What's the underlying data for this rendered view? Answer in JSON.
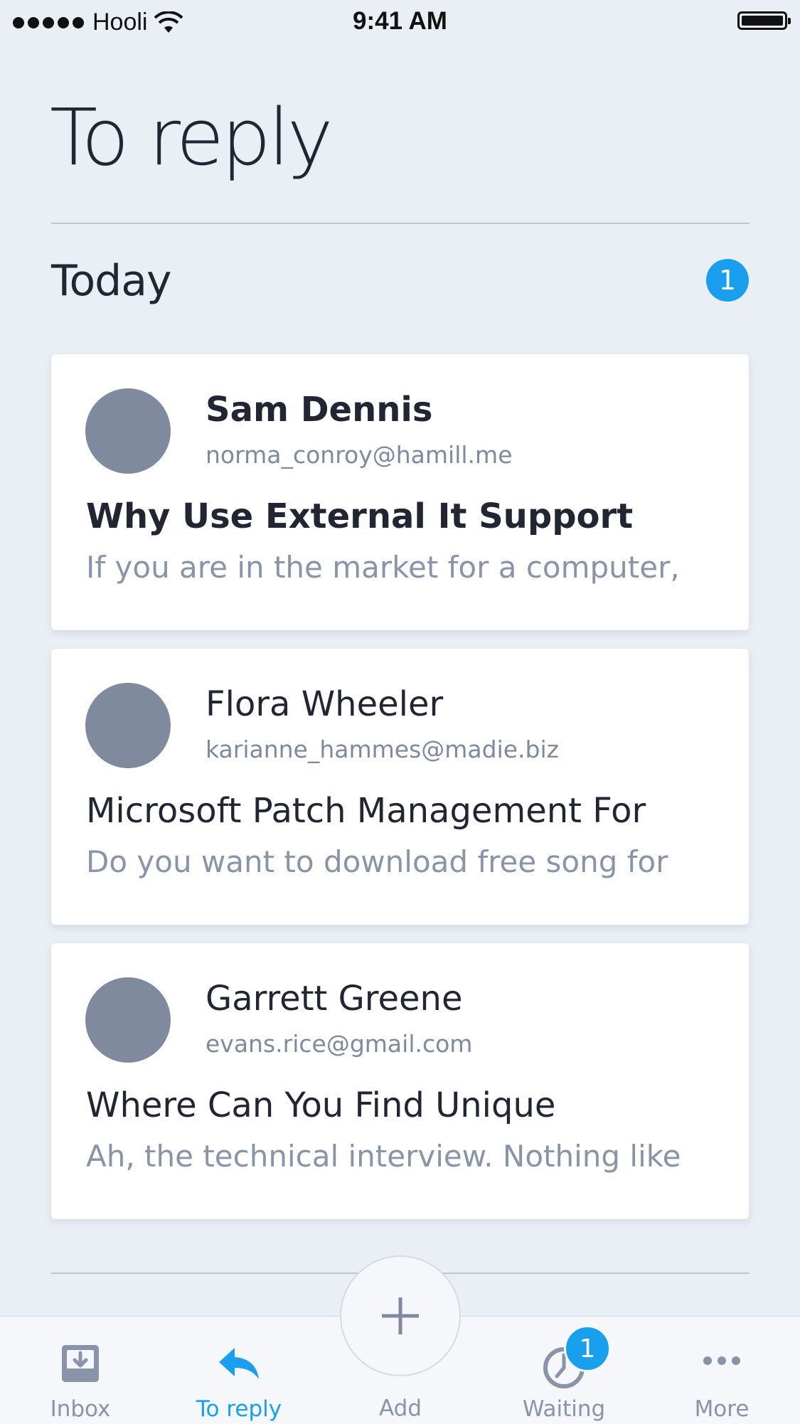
{
  "status_bar": {
    "carrier": "Hooli",
    "time": "9:41 AM"
  },
  "header": {
    "title": "To reply"
  },
  "section": {
    "title": "Today",
    "count": "1"
  },
  "cards": [
    {
      "sender": "Sam Dennis",
      "email": "norma_conroy@hamill.me",
      "subject": "Why Use External It Support",
      "preview": "If you are in the market for a computer,",
      "unread": true
    },
    {
      "sender": "Flora Wheeler",
      "email": "karianne_hammes@madie.biz",
      "subject": "Microsoft Patch Management For",
      "preview": "Do you want to download free song for",
      "unread": false
    },
    {
      "sender": "Garrett Greene",
      "email": "evans.rice@gmail.com",
      "subject": "Where Can You Find Unique",
      "preview": "Ah, the technical interview. Nothing like",
      "unread": false
    }
  ],
  "tab_bar": {
    "inbox": {
      "label": "Inbox",
      "icon": "inbox-icon"
    },
    "to_reply": {
      "label": "To reply",
      "icon": "reply-icon",
      "active": true
    },
    "add": {
      "label": "Add",
      "icon": "plus-icon"
    },
    "waiting": {
      "label": "Waiting",
      "icon": "clock-icon",
      "badge": "1"
    },
    "more": {
      "label": "More",
      "icon": "more-icon"
    }
  },
  "colors": {
    "accent": "#1A9FEF",
    "background": "#EAEEF5",
    "avatar": "#7F8A9E",
    "muted_text": "#8A94A8",
    "primary_text": "#222633"
  }
}
